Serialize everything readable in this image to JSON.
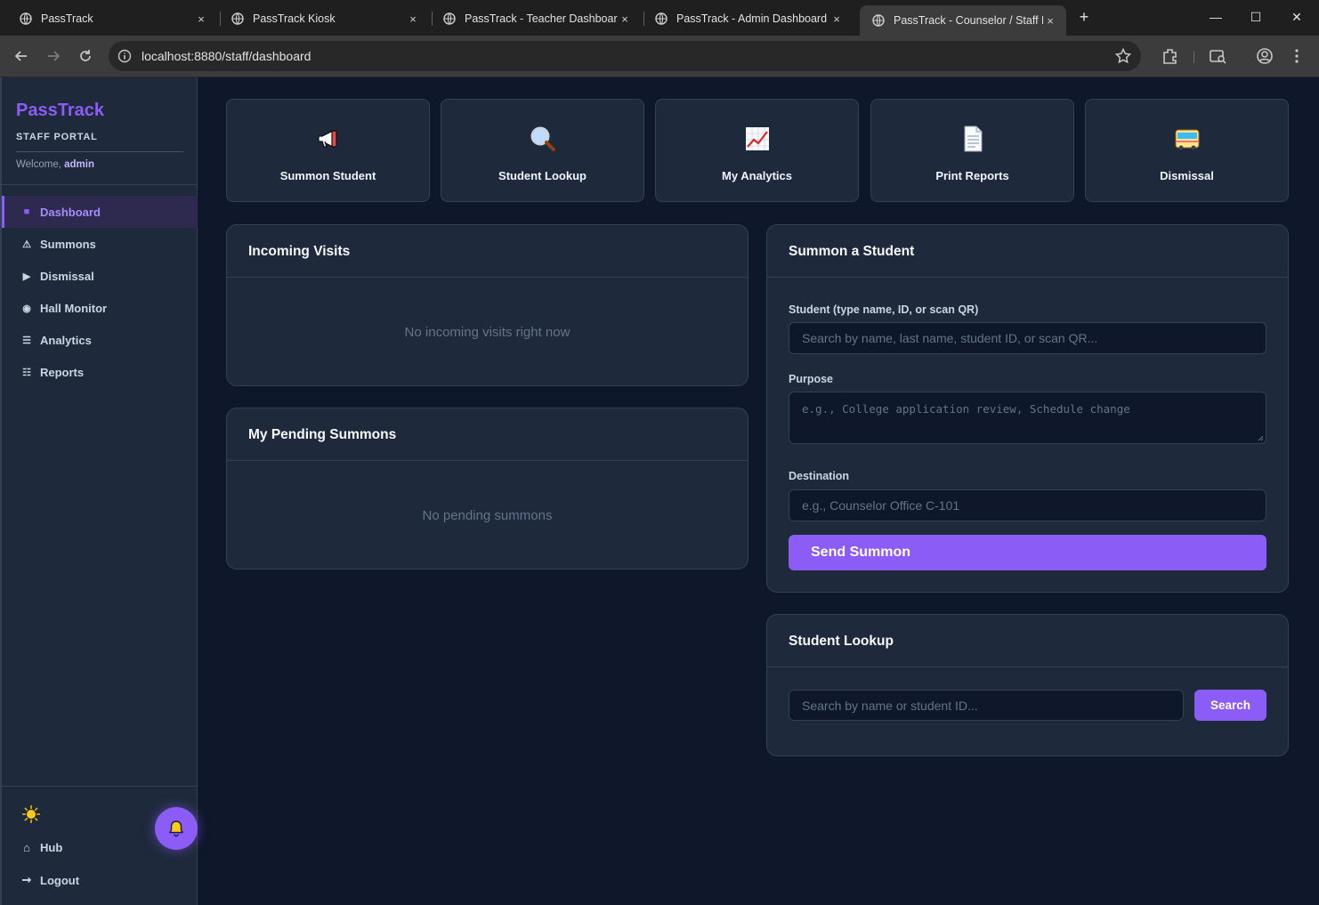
{
  "browser": {
    "tabs": [
      {
        "title": "PassTrack",
        "close": "×"
      },
      {
        "title": "PassTrack Kiosk",
        "close": "×"
      },
      {
        "title": "PassTrack - Teacher Dashboard",
        "close": "×"
      },
      {
        "title": "PassTrack - Admin Dashboard",
        "close": "×"
      },
      {
        "title": "PassTrack - Counselor / Staff Po",
        "close": "×",
        "active": true
      }
    ],
    "new_tab": "+",
    "url": "localhost:8880/staff/dashboard",
    "window_controls": {
      "minimize": "—",
      "maximize": "☐",
      "close": "✕"
    }
  },
  "sidebar": {
    "brand": "PassTrack",
    "subtitle": "STAFF PORTAL",
    "welcome_prefix": "Welcome,",
    "username": "admin",
    "items": [
      {
        "label": "Dashboard",
        "icon": "■",
        "active": true
      },
      {
        "label": "Summons",
        "icon": "⚠"
      },
      {
        "label": "Dismissal",
        "icon": "▶"
      },
      {
        "label": "Hall Monitor",
        "icon": "◉"
      },
      {
        "label": "Analytics",
        "icon": "☰"
      },
      {
        "label": "Reports",
        "icon": "☷"
      }
    ],
    "theme_icon": "sun-icon",
    "bottom_items": [
      {
        "label": "Hub",
        "icon": "⌂"
      },
      {
        "label": "Logout",
        "icon": "➞"
      }
    ],
    "notification_icon": "bell-icon"
  },
  "quick_actions": [
    {
      "label": "Summon Student",
      "icon": "megaphone-icon"
    },
    {
      "label": "Student Lookup",
      "icon": "magnifier-icon"
    },
    {
      "label": "My Analytics",
      "icon": "chart-icon"
    },
    {
      "label": "Print Reports",
      "icon": "document-icon"
    },
    {
      "label": "Dismissal",
      "icon": "bus-icon"
    }
  ],
  "incoming_visits": {
    "title": "Incoming Visits",
    "empty": "No incoming visits right now"
  },
  "pending_summons": {
    "title": "My Pending Summons",
    "empty": "No pending summons"
  },
  "summon_form": {
    "title": "Summon a Student",
    "student_label": "Student (type name, ID, or scan QR)",
    "student_placeholder": "Search by name, last name, student ID, or scan QR...",
    "purpose_label": "Purpose",
    "purpose_placeholder": "e.g., College application review, Schedule change",
    "destination_label": "Destination",
    "destination_placeholder": "e.g., Counselor Office C-101",
    "submit": "Send Summon"
  },
  "lookup": {
    "title": "Student Lookup",
    "placeholder": "Search by name or student ID...",
    "button": "Search"
  },
  "colors": {
    "accent": "#8b5cf6",
    "background": "#0f172a",
    "surface": "#1e293b",
    "border": "#334155"
  }
}
